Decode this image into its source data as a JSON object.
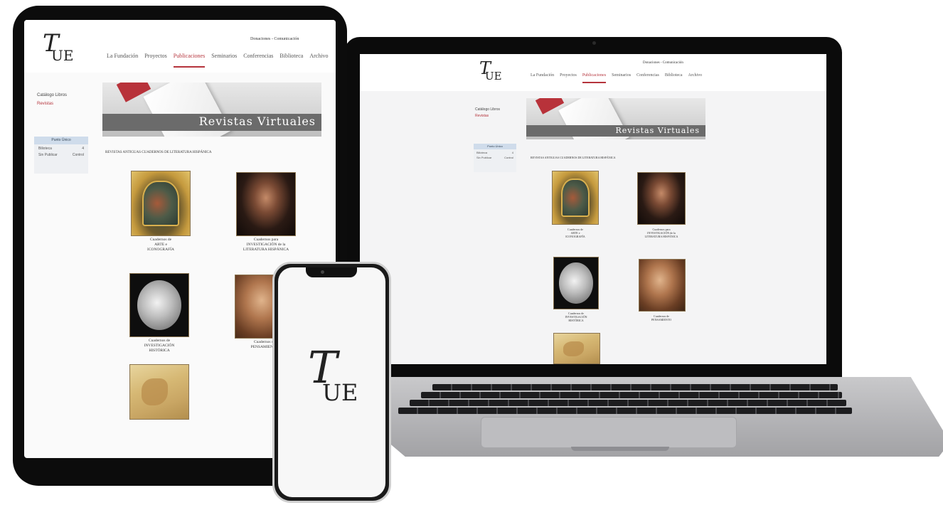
{
  "brand": {
    "logo_t": "T",
    "logo_ue": "UE",
    "header_link": "Donaciones - Comunicación",
    "accent_color": "#b5343c"
  },
  "nav": {
    "items": [
      "La Fundación",
      "Proyectos",
      "Publicaciones",
      "Seminarios",
      "Conferencias",
      "Biblioteca",
      "Archivo"
    ],
    "active": "Publicaciones"
  },
  "sidebar": {
    "links": [
      "Catálogo Libros",
      "Revistas"
    ],
    "active_link": "Revistas",
    "box_title": "Punto Único",
    "rows": [
      {
        "label": "Bilioteca",
        "value": "4"
      },
      {
        "label": "Sin Publicar",
        "value": "Control"
      }
    ]
  },
  "banner": {
    "title": "Revistas Virtuales"
  },
  "section": {
    "title": "REVISTAS ANTIGUAS CUADERNOS DE LITERATURA HISPÁNICA"
  },
  "journals": [
    {
      "art": "arte",
      "lines": [
        "Cuadernos de",
        "ARTE e",
        "ICONOGRAFÍA"
      ]
    },
    {
      "art": "portrait",
      "lines": [
        "Cuadernos para",
        "INVESTIGACIÓN de la",
        "LITERATURA HISPÁNICA"
      ]
    },
    {
      "art": "coin",
      "lines": [
        "Cuadernos de",
        "INVESTIGACIÓN",
        "HISTÓRICA"
      ]
    },
    {
      "art": "knight",
      "lines": [
        "Cuadernos de",
        "PENSAMIENTO"
      ]
    },
    {
      "art": "map",
      "lines": []
    }
  ],
  "phone": {
    "logo_t": "T",
    "logo_ue": "UE"
  }
}
